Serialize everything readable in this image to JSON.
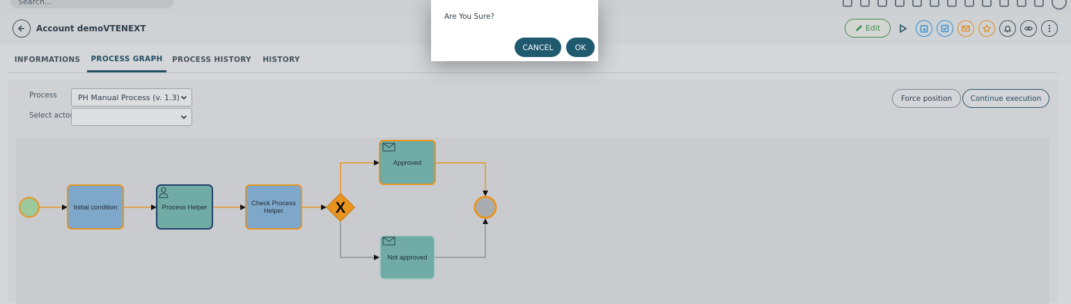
{
  "topbar": {
    "search_placeholder": "Search..."
  },
  "header": {
    "title": "Account demoVTENEXT",
    "edit_label": "Edit"
  },
  "tabs": [
    {
      "label": "INFORMATIONS"
    },
    {
      "label": "PROCESS GRAPH"
    },
    {
      "label": "PROCESS HISTORY"
    },
    {
      "label": "HISTORY"
    }
  ],
  "form": {
    "process_label": "Process",
    "process_value": "PH Manual Process (v. 1.3)",
    "actor_label": "Select actor",
    "actor_value": ""
  },
  "buttons": {
    "force_position": "Force position",
    "continue_execution": "Continue execution"
  },
  "graph": {
    "nodes": {
      "initial_condition": "Initial condition",
      "process_helper": "Process Helper",
      "check_process_helper_1": "Check Process",
      "check_process_helper_2": "Helper",
      "gateway": "X",
      "approved": "Approved",
      "not_approved": "Not approved"
    }
  },
  "modal": {
    "message": "Are You Sure?",
    "cancel_label": "CANCEL",
    "ok_label": "OK"
  },
  "colors": {
    "accent": "#1f5a6f",
    "edit_green": "#3f8a4e",
    "task_blue": "#7fa7c9",
    "task_teal": "#70aca5",
    "flow_orange": "#e8941e"
  }
}
